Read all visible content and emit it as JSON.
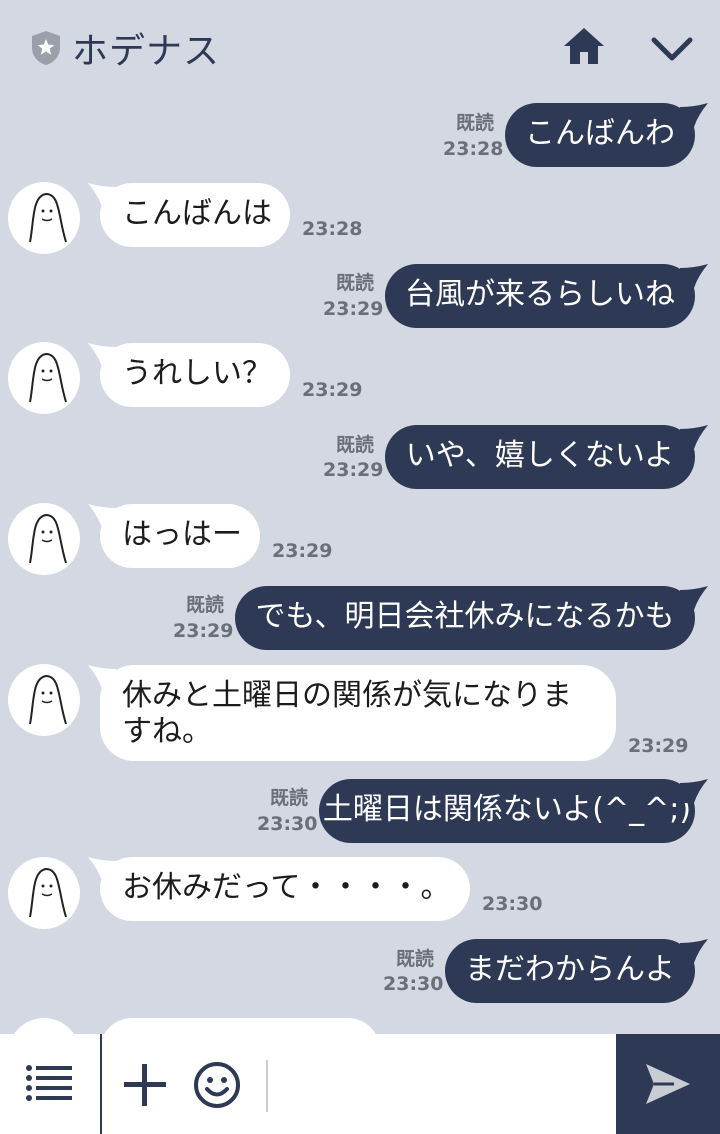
{
  "header": {
    "title": "ホデナス"
  },
  "messages": [
    {
      "dir": "out",
      "text": "こんばんわ",
      "read": "既読",
      "time": "23:28"
    },
    {
      "dir": "in",
      "text": "こんばんは",
      "time": "23:28"
    },
    {
      "dir": "out",
      "text": "台風が来るらしいね",
      "read": "既読",
      "time": "23:29"
    },
    {
      "dir": "in",
      "text": "うれしい？",
      "time": "23:29"
    },
    {
      "dir": "out",
      "text": "いや、嬉しくないよ",
      "read": "既読",
      "time": "23:29"
    },
    {
      "dir": "in",
      "text": "はっはー",
      "time": "23:29"
    },
    {
      "dir": "out",
      "text": "でも、明日会社休みになるかも",
      "read": "既読",
      "time": "23:29"
    },
    {
      "dir": "in",
      "text": "休みと土曜日の関係が気になりますね。",
      "time": "23:29"
    },
    {
      "dir": "out",
      "text": "土曜日は関係ないよ(^_^;)",
      "read": "既読",
      "time": "23:30"
    },
    {
      "dir": "in",
      "text": "お休みだって・・・・。",
      "time": "23:30"
    },
    {
      "dir": "out",
      "text": "まだわからんよ",
      "read": "既読",
      "time": "23:30"
    }
  ],
  "footer": {
    "input_value": ""
  },
  "colors": {
    "background": "#d3d8e2",
    "outgoing_bubble": "#2e3a55",
    "incoming_bubble": "#ffffff",
    "send_button": "#2e3a55"
  },
  "icons": [
    "shield-star-icon",
    "home-icon",
    "chevron-down-icon",
    "menu-icon",
    "plus-icon",
    "smile-icon",
    "send-icon",
    "avatar-face-icon"
  ]
}
